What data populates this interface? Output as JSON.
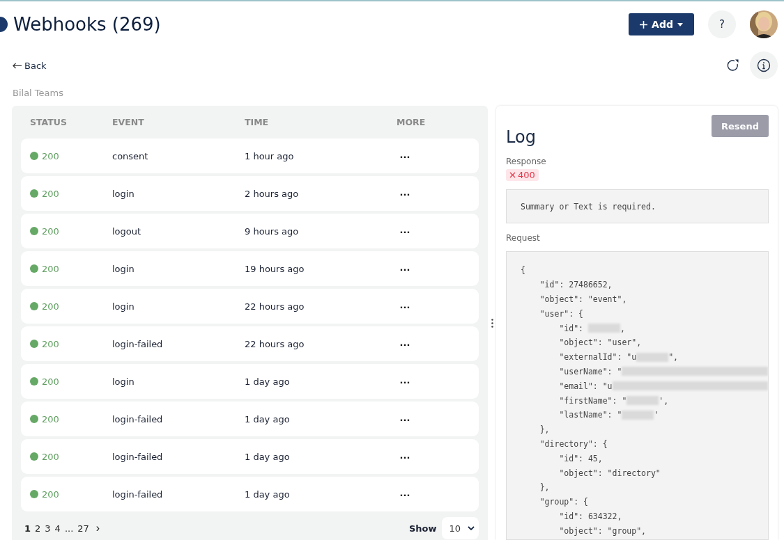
{
  "header": {
    "title": "Webhooks (269)",
    "add_button": "Add",
    "help_button": "?"
  },
  "back_link": "Back",
  "team": "Bilal Teams",
  "table": {
    "columns": [
      "STATUS",
      "EVENT",
      "TIME",
      "MORE"
    ],
    "rows": [
      {
        "status": "200",
        "color": "#66a866",
        "event": "consent",
        "time": "1 hour ago",
        "more": "···"
      },
      {
        "status": "200",
        "color": "#66a866",
        "event": "login",
        "time": "2 hours ago",
        "more": "···"
      },
      {
        "status": "200",
        "color": "#66a866",
        "event": "logout",
        "time": "9 hours ago",
        "more": "···"
      },
      {
        "status": "200",
        "color": "#66a866",
        "event": "login",
        "time": "19 hours ago",
        "more": "···"
      },
      {
        "status": "200",
        "color": "#66a866",
        "event": "login",
        "time": "22 hours ago",
        "more": "···"
      },
      {
        "status": "200",
        "color": "#66a866",
        "event": "login-failed",
        "time": "22 hours ago",
        "more": "···"
      },
      {
        "status": "200",
        "color": "#66a866",
        "event": "login",
        "time": "1 day ago",
        "more": "···"
      },
      {
        "status": "200",
        "color": "#66a866",
        "event": "login-failed",
        "time": "1 day ago",
        "more": "···"
      },
      {
        "status": "200",
        "color": "#66a866",
        "event": "login-failed",
        "time": "1 day ago",
        "more": "···"
      },
      {
        "status": "200",
        "color": "#66a866",
        "event": "login-failed",
        "time": "1 day ago",
        "more": "···"
      }
    ]
  },
  "pagination": {
    "pages": [
      {
        "label": "1",
        "selected": true
      },
      {
        "label": "2",
        "selected": false
      },
      {
        "label": "3",
        "selected": false
      },
      {
        "label": "4",
        "selected": false
      },
      {
        "label": "...",
        "selected": false
      },
      {
        "label": "27",
        "selected": false
      }
    ],
    "next": "›",
    "show_label": "Show",
    "page_size": "10"
  },
  "log": {
    "title": "Log",
    "resend_button": "Resend",
    "response_label": "Response",
    "response_code": "400",
    "response_body": "Summary or Text is required.",
    "request_label": "Request",
    "request_lines": [
      {
        "text": "{"
      },
      {
        "text": "    \"id\": 27486652,"
      },
      {
        "text": "    \"object\": \"event\","
      },
      {
        "text": "    \"user\": {"
      },
      {
        "text": "        \"id\": ",
        "redacted": true,
        "wide": false,
        "suffix": ","
      },
      {
        "text": "        \"object\": \"user\","
      },
      {
        "text": "        \"externalId\": \"u",
        "redacted": true,
        "wide": false,
        "suffix": "\","
      },
      {
        "text": "        \"userName\": \"",
        "redacted": true,
        "wide": true
      },
      {
        "text": "        \"email\": \"u",
        "redacted": true,
        "wide": true
      },
      {
        "text": "        \"firstName\": \"",
        "redacted": true,
        "wide": false,
        "suffix": "',"
      },
      {
        "text": "        \"lastName\": \"",
        "redacted": true,
        "wide": false,
        "suffix": "'"
      },
      {
        "text": "    },"
      },
      {
        "text": "    \"directory\": {"
      },
      {
        "text": "        \"id\": 45,"
      },
      {
        "text": "        \"object\": \"directory\""
      },
      {
        "text": "    },"
      },
      {
        "text": "    \"group\": {"
      },
      {
        "text": "        \"id\": 634322,"
      },
      {
        "text": "        \"object\": \"group\","
      }
    ]
  }
}
